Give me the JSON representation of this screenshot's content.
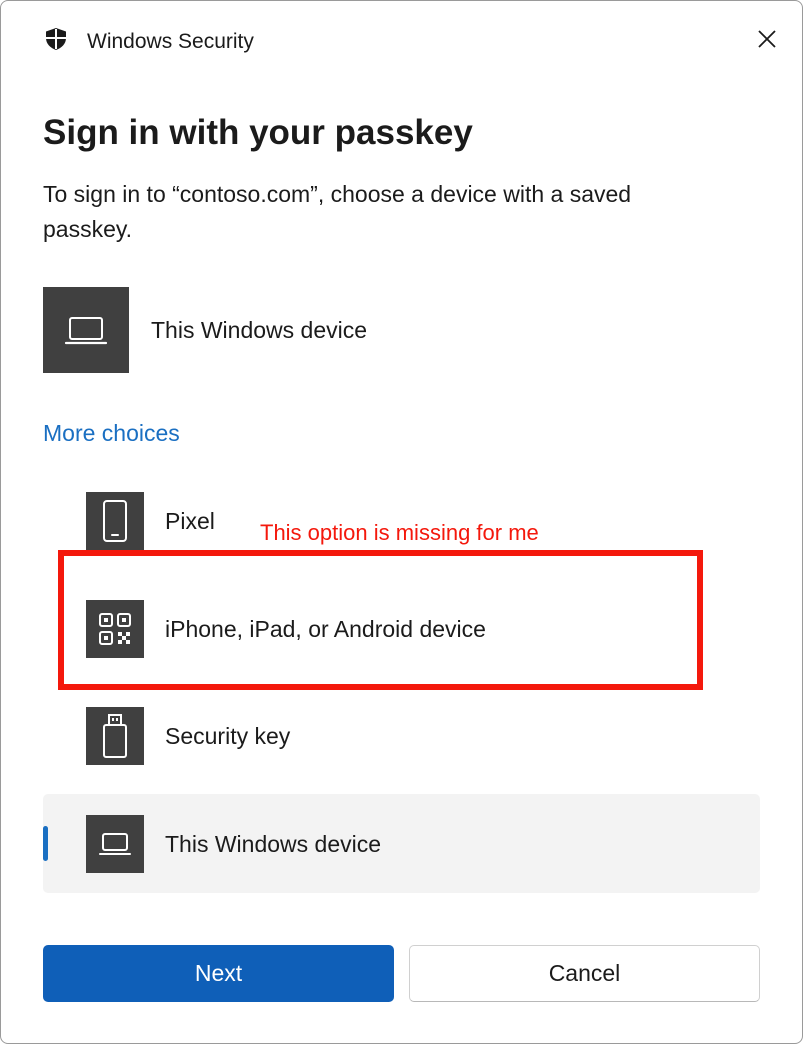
{
  "window": {
    "title": "Windows Security",
    "close_icon": "close-icon",
    "brand_icon": "shield-icon"
  },
  "dialog": {
    "heading": "Sign in with your passkey",
    "description": "To sign in to “contoso.com”, choose a device with a saved passkey.",
    "primary_option": {
      "label": "This Windows device",
      "icon": "laptop-icon"
    },
    "more_choices_label": "More choices",
    "choices": [
      {
        "label": "Pixel",
        "icon": "phone-icon"
      },
      {
        "label": "iPhone, iPad, or Android device",
        "icon": "qr-code-icon"
      },
      {
        "label": "Security key",
        "icon": "usb-key-icon"
      },
      {
        "label": "This Windows device",
        "icon": "laptop-icon",
        "selected": true
      }
    ]
  },
  "annotation": {
    "text": "This option is missing for me",
    "color": "#f4180c"
  },
  "buttons": {
    "next_label": "Next",
    "cancel_label": "Cancel"
  },
  "colors": {
    "accent": "#0f5fb8",
    "link": "#1a6fc2",
    "icon_tile": "#404040",
    "selected_bg": "#f3f3f3"
  }
}
